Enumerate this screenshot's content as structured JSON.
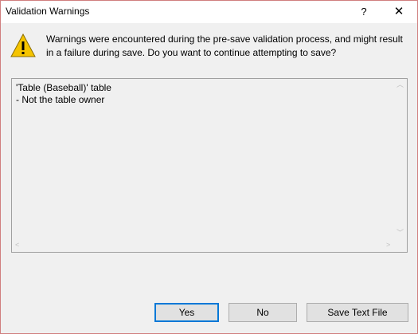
{
  "window": {
    "title": "Validation Warnings",
    "help_glyph": "?",
    "close_glyph": "✕"
  },
  "icons": {
    "warning": "warning-icon"
  },
  "message": {
    "line1": "Warnings were encountered during the pre-save validation process, and might result",
    "line2": "in a failure during save. Do you want to continue attempting to save?"
  },
  "details": {
    "lines": [
      "'Table (Baseball)' table",
      "- Not the table owner"
    ]
  },
  "buttons": {
    "yes": "Yes",
    "no": "No",
    "save_text_file": "Save Text File"
  },
  "colors": {
    "accent": "#0078d7",
    "warning_fill": "#f5c400"
  }
}
